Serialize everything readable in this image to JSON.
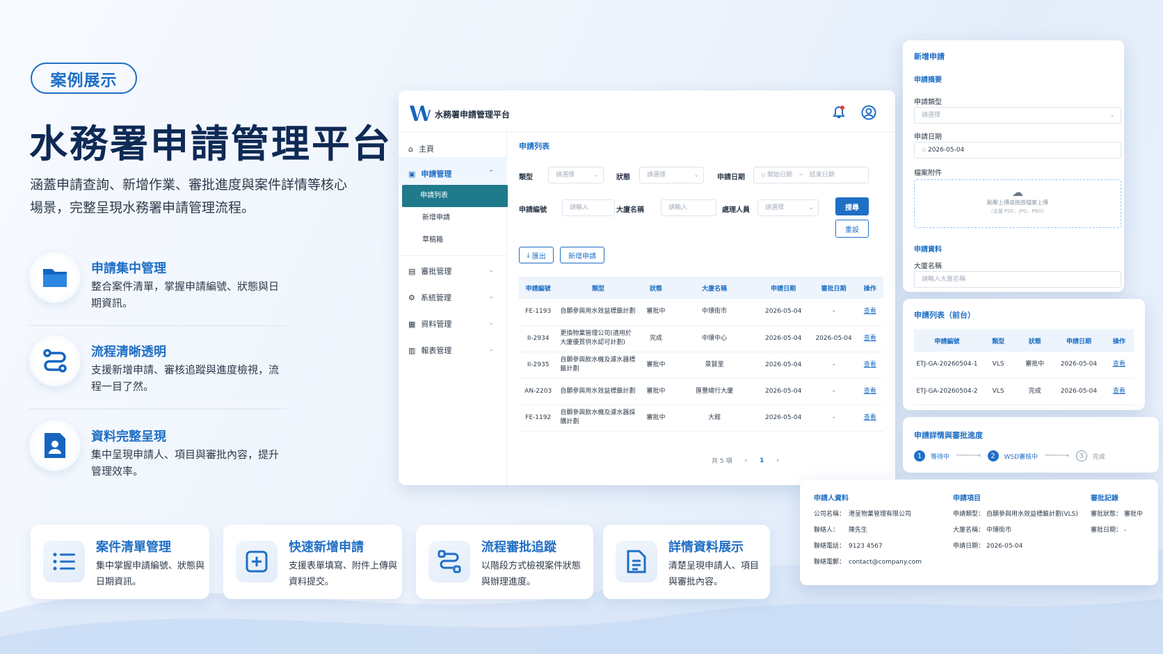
{
  "hero": {
    "badge": "案例展示",
    "title": "水務署申請管理平台",
    "desc": "涵蓋申請查詢、新增作業、審批進度與案件詳情等核心場景，完整呈現水務署申請管理流程。"
  },
  "features": [
    {
      "title": "申請集中管理",
      "desc": "整合案件清單，掌握申請編號、狀態與日期資訊。",
      "icon": "folder-icon"
    },
    {
      "title": "流程清晰透明",
      "desc": "支援新增申請、審核追蹤與進度檢視，流程一目了然。",
      "icon": "route-icon"
    },
    {
      "title": "資料完整呈現",
      "desc": "集中呈現申請人、項目與審批內容，提升管理效率。",
      "icon": "user-document-icon"
    }
  ],
  "cards": [
    {
      "title": "案件清單管理",
      "desc": "集中掌握申請編號、狀態與日期資訊。",
      "icon": "list-icon"
    },
    {
      "title": "快速新增申請",
      "desc": "支援表單填寫、附件上傳與資料提交。",
      "icon": "add-square-icon"
    },
    {
      "title": "流程審批追蹤",
      "desc": "以階段方式檢視案件狀態與辦理進度。",
      "icon": "flow-icon"
    },
    {
      "title": "詳情資料展示",
      "desc": "清楚呈現申請人、項目與審批內容。",
      "icon": "document-icon"
    }
  ],
  "app": {
    "title": "水務署申請管理平台",
    "menu": {
      "home": "主頁",
      "apply": "申請管理",
      "apply_sub": [
        "申請列表",
        "新增申請",
        "草稿箱"
      ],
      "approve": "審批管理",
      "system": "系統管理",
      "data": "資料管理",
      "report": "報表管理"
    },
    "section_title": "申請列表",
    "filters": {
      "type_label": "類型",
      "type_ph": "請選擇",
      "status_label": "狀態",
      "status_ph": "請選擇",
      "date_label": "申請日期",
      "date_start": "開始日期",
      "date_sep": "~",
      "date_end": "結束日期",
      "no_label": "申請編號",
      "no_ph": "請輸入",
      "building_label": "大廈名稱",
      "building_ph": "請輸入",
      "handler_label": "處理人員",
      "handler_ph": "請選擇",
      "search": "搜尋",
      "reset": "重設"
    },
    "actions": {
      "export": "匯出",
      "new": "新增申請"
    },
    "table": {
      "headers": [
        "申請編號",
        "類型",
        "狀態",
        "大廈名稱",
        "申請日期",
        "審批日期",
        "操作"
      ],
      "rows": [
        [
          "FE-1193",
          "自願參與用水效益標籤計劃",
          "審批中",
          "中環街市",
          "2026-05-04",
          "-",
          "查看"
        ],
        [
          "II-2934",
          "更換物業管理公司(適用於大廈優質供水認可計劃)",
          "完成",
          "中環中心",
          "2026-05-04",
          "2026-05-04",
          "查看"
        ],
        [
          "II-2935",
          "自願參與飲水機及濾水器標籤計劃",
          "審批中",
          "景賢里",
          "2026-05-04",
          "-",
          "查看"
        ],
        [
          "AN-2203",
          "自願參與用水效益標籤計劃",
          "審批中",
          "匯豐總行大廈",
          "2026-05-04",
          "-",
          "查看"
        ],
        [
          "FE-1192",
          "自願參與飲水機及濾水器採購計劃",
          "審批中",
          "大館",
          "2026-05-04",
          "-",
          "查看"
        ]
      ]
    },
    "pager": {
      "total": "共 5 項",
      "prev": "‹",
      "page": "1",
      "next": "›"
    }
  },
  "new_form": {
    "title": "新增申請",
    "summary": "申請摘要",
    "type_label": "申請類型",
    "type_ph": "請選擇",
    "date_label": "申請日期",
    "date_value": "2026-05-04",
    "attach_label": "檔案附件",
    "upload_text": "點擊上傳或拖放檔案上傳",
    "upload_hint": "(支援 PDF、JPG、PNG)",
    "info": "申請資料",
    "building_label": "大廈名稱",
    "building_ph": "請輸入大廈名稱"
  },
  "front_list": {
    "title": "申請列表（前台）",
    "headers": [
      "申請編號",
      "類型",
      "狀態",
      "申請日期",
      "操作"
    ],
    "rows": [
      [
        "ETJ-GA-20260504-1",
        "VLS",
        "審批中",
        "2026-05-04",
        "查看"
      ],
      [
        "ETJ-GA-20260504-2",
        "VLS",
        "完成",
        "2026-05-04",
        "查看"
      ]
    ]
  },
  "progress": {
    "title": "申請詳情與審批進度",
    "steps": [
      {
        "num": "1",
        "label": "等待中"
      },
      {
        "num": "2",
        "label": "WSD審核中"
      },
      {
        "num": "3",
        "label": "完成"
      }
    ]
  },
  "details": {
    "applicant_title": "申請人資料",
    "applicant": [
      {
        "k": "公司名稱：",
        "v": "港呈物業管理有限公司"
      },
      {
        "k": "聯絡人：",
        "v": "陳先生"
      },
      {
        "k": "聯絡電話：",
        "v": "9123 4567"
      },
      {
        "k": "聯絡電郵：",
        "v": "contact@company.com"
      }
    ],
    "item_title": "申請項目",
    "item": [
      {
        "k": "申請類型：",
        "v": "自願參與用水效益標籤計劃(VLS)"
      },
      {
        "k": "大廈名稱：",
        "v": "中環街市"
      },
      {
        "k": "申請日期：",
        "v": "2026-05-04"
      }
    ],
    "record_title": "審批記錄",
    "record": [
      {
        "k": "審批狀態：",
        "v": "審批中"
      },
      {
        "k": "審批日期：",
        "v": "-"
      }
    ]
  },
  "colors": {
    "primary": "#1f6fc5",
    "navy": "#0e2a55",
    "active": "#1f7a8c"
  }
}
